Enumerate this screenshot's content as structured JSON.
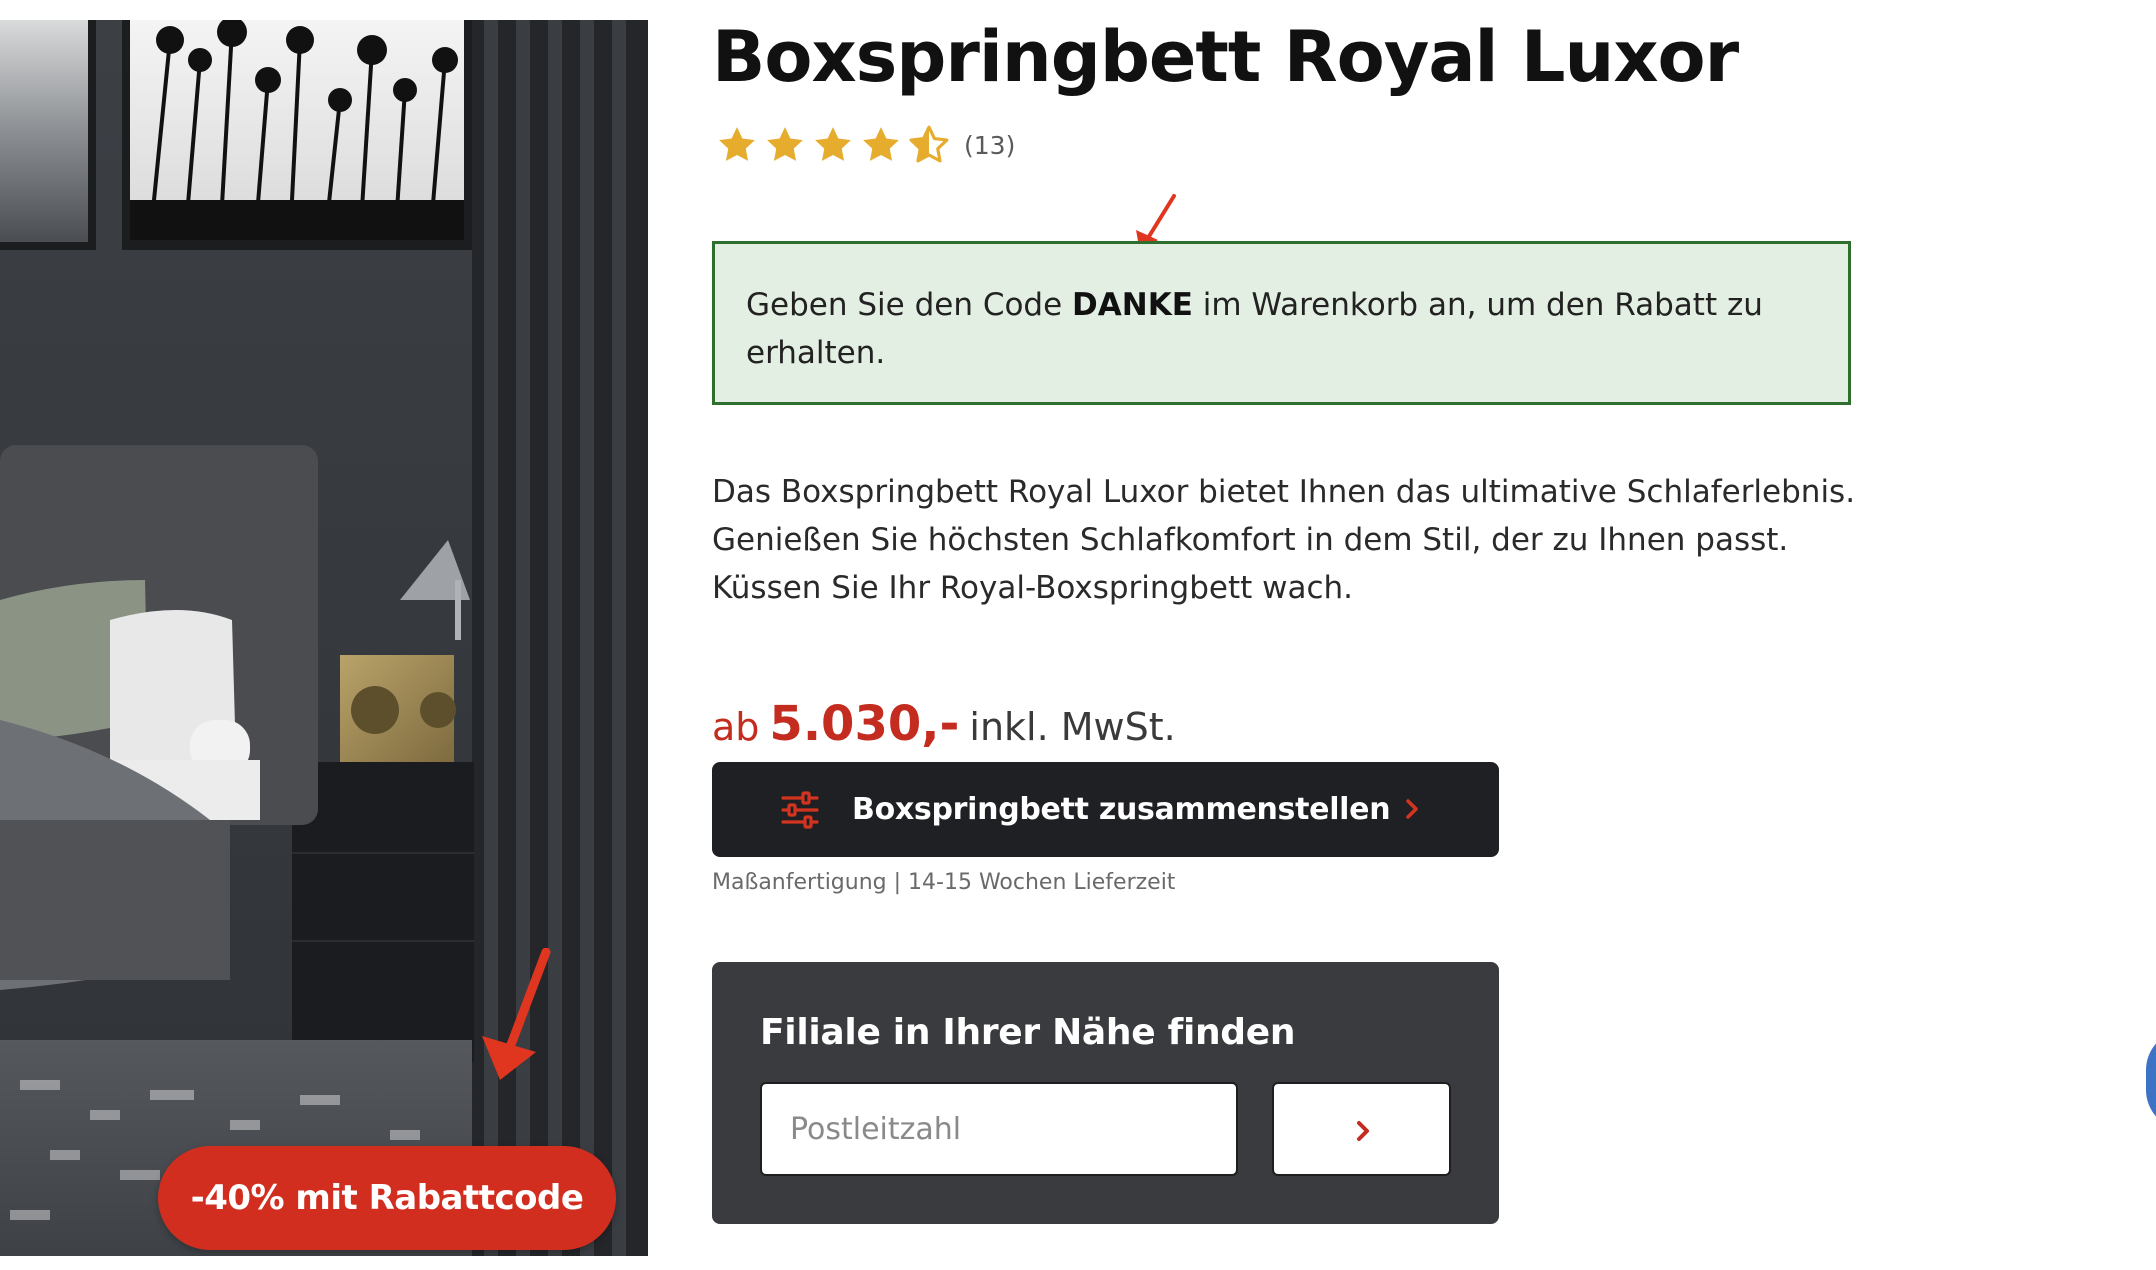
{
  "product": {
    "title": "Boxspringbett Royal Luxor",
    "rating": {
      "stars": 4.5,
      "max": 5,
      "count_label": "(13)"
    },
    "image_badge": "-40% mit Rabattcode"
  },
  "promo": {
    "text_before": "Geben Sie den Code ",
    "code": "DANKE",
    "text_after": " im Warenkorb an, um den Rabatt zu erhalten."
  },
  "description": "Das Boxspringbett Royal Luxor bietet Ihnen das ultimative Schlaferlebnis. Genießen Sie höchsten Schlafkomfort in dem Stil, der zu Ihnen passt. Küssen Sie Ihr Royal-Boxspringbett wach.",
  "price": {
    "prefix": "ab",
    "value": "5.030,-",
    "suffix": "inkl. MwSt."
  },
  "configure": {
    "label": "Boxspringbett zusammenstellen",
    "icon": "sliders-icon"
  },
  "delivery_note": "Maßanfertigung | 14-15 Wochen Lieferzeit",
  "store_finder": {
    "title": "Filiale in Ihrer Nähe finden",
    "zip_placeholder": "Postleitzahl",
    "zip_value": ""
  },
  "colors": {
    "accent_red": "#c32c1e",
    "badge_red": "#d22e1f",
    "dark_button": "#1e2023",
    "finder_bg": "#3a3b3e",
    "promo_bg": "#e4efe3",
    "promo_border": "#2e6f2e",
    "star_gold": "#e6ac2e"
  }
}
